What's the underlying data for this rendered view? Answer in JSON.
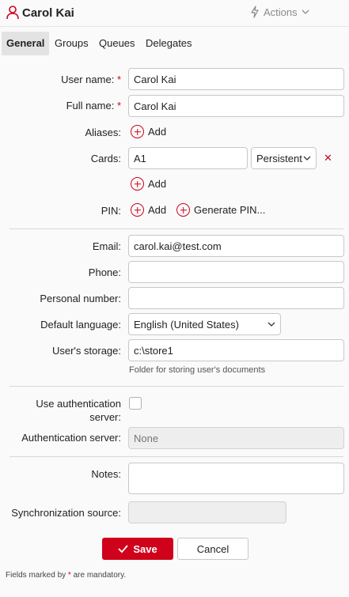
{
  "header": {
    "title": "Carol Kai",
    "actions_label": "Actions"
  },
  "tabs": [
    {
      "label": "General"
    },
    {
      "label": "Groups"
    },
    {
      "label": "Queues"
    },
    {
      "label": "Delegates"
    }
  ],
  "form": {
    "user_name": {
      "label": "User name:",
      "value": "Carol Kai",
      "required_mark": "*"
    },
    "full_name": {
      "label": "Full name:",
      "value": "Carol Kai",
      "required_mark": "*"
    },
    "aliases": {
      "label": "Aliases:",
      "add_label": "Add"
    },
    "cards": {
      "label": "Cards:",
      "value": "A1",
      "type": "Persistent",
      "remove_glyph": "✕",
      "add_label": "Add"
    },
    "pin": {
      "label": "PIN:",
      "add_label": "Add",
      "generate_label": "Generate PIN..."
    },
    "email": {
      "label": "Email:",
      "value": "carol.kai@test.com"
    },
    "phone": {
      "label": "Phone:",
      "value": ""
    },
    "personal_number": {
      "label": "Personal number:",
      "value": ""
    },
    "default_language": {
      "label": "Default language:",
      "value": "English (United States)"
    },
    "storage": {
      "label": "User's storage:",
      "value": "c:\\store1",
      "hint": "Folder for storing user's documents"
    },
    "use_auth_server": {
      "label_line1": "Use authentication",
      "label_line2": "server:"
    },
    "auth_server": {
      "label": "Authentication server:",
      "placeholder": "None"
    },
    "notes": {
      "label": "Notes:",
      "value": ""
    },
    "sync_source": {
      "label": "Synchronization source:",
      "value": ""
    }
  },
  "buttons": {
    "save": "Save",
    "cancel": "Cancel"
  },
  "footnote": {
    "prefix": "Fields marked by ",
    "mark": "*",
    "suffix": " are mandatory."
  },
  "colors": {
    "accent": "#d0021b",
    "background": "#fafafa"
  }
}
